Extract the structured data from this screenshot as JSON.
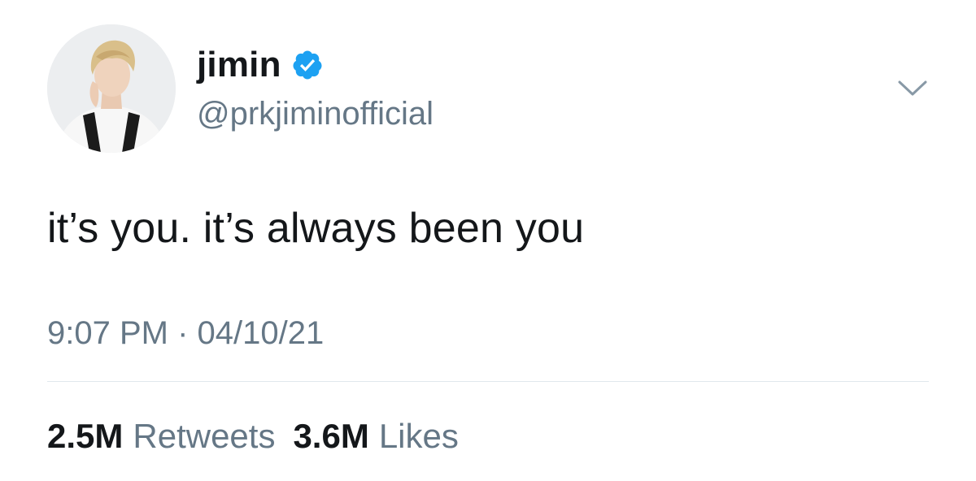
{
  "tweet": {
    "author": {
      "display_name": "jimin",
      "handle": "@prkjiminofficial",
      "verified": true
    },
    "text": "it’s you. it’s always been you",
    "timestamp": "9:07 PM · 04/10/21",
    "stats": {
      "retweets_count": "2.5M",
      "retweets_label": "Retweets",
      "likes_count": "3.6M",
      "likes_label": "Likes"
    }
  },
  "colors": {
    "text_primary": "#14171a",
    "text_secondary": "#657786",
    "verified_blue": "#1da1f2",
    "divider": "#e1e8ed"
  },
  "icons": {
    "verified": "verified-badge-icon",
    "caret": "chevron-down-icon"
  }
}
